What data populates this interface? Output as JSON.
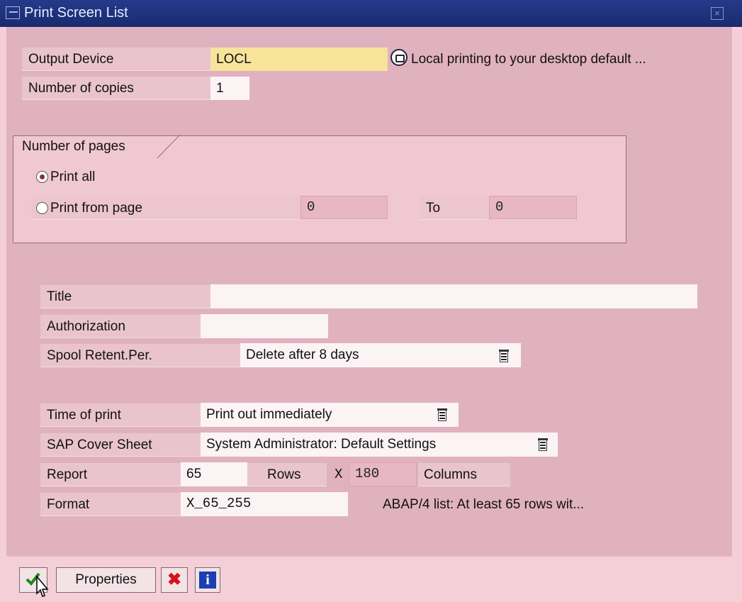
{
  "window": {
    "title": "Print Screen List"
  },
  "output_device": {
    "label": "Output Device",
    "value": "LOCL",
    "description": "Local printing to your desktop default ..."
  },
  "copies": {
    "label": "Number of copies",
    "value": "1"
  },
  "pages": {
    "group_title": "Number of pages",
    "print_all": "Print all",
    "print_from": "Print from page",
    "from_value": "0",
    "to_label": "To",
    "to_value": "0"
  },
  "title_field": {
    "label": "Title",
    "value": ""
  },
  "authorization": {
    "label": "Authorization",
    "value": ""
  },
  "spool": {
    "label": "Spool Retent.Per.",
    "value": "Delete after 8 days"
  },
  "time_of_print": {
    "label": "Time of print",
    "value": "Print out immediately"
  },
  "cover_sheet": {
    "label": "SAP Cover Sheet",
    "value": "System Administrator: Default Settings"
  },
  "report": {
    "label": "Report",
    "rows": "65",
    "rows_label": "Rows",
    "x": "X",
    "columns": "180",
    "columns_label": "Columns"
  },
  "format": {
    "label": "Format",
    "value": "X_65_255",
    "description": "ABAP/4 list: At least 65 rows wit..."
  },
  "buttons": {
    "properties": "Properties"
  },
  "colors": {
    "titlebar": "#1a2a6e",
    "background": "#e0b2bf",
    "highlight_field": "#f7e39a"
  }
}
